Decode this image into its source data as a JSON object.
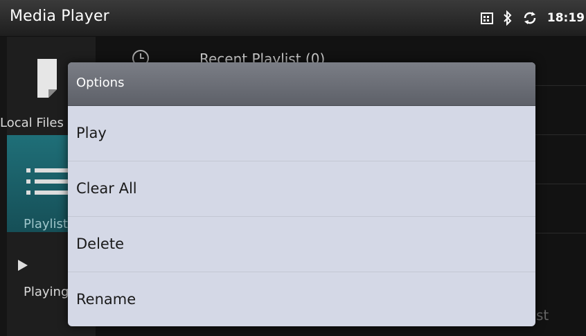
{
  "app": {
    "title": "Media Player",
    "clock": "18:19"
  },
  "status_icons": [
    "calendar-icon",
    "bluetooth-icon",
    "sync-icon"
  ],
  "sidebar": {
    "items": [
      {
        "label": "Local Files",
        "icon": "file-icon",
        "selected": false
      },
      {
        "label": "Playlist",
        "icon": "list-icon",
        "selected": true
      },
      {
        "label": "Playing",
        "icon": "play-icon",
        "selected": false
      }
    ]
  },
  "list": {
    "rows": [
      {
        "label": "Recent Playlist  (0)",
        "icon": "clock-icon"
      },
      {
        "label": ""
      },
      {
        "label": ""
      },
      {
        "label": ""
      },
      {
        "label": "st"
      }
    ]
  },
  "dialog": {
    "title": "Options",
    "options": [
      "Play",
      "Clear All",
      "Delete",
      "Rename"
    ]
  },
  "colors": {
    "dialog_bg": "#d4d8e6",
    "header_bg": "#6b6e76",
    "sidebar_selected": "#1f6f78",
    "titlebar_bg": "#2a2a2a"
  }
}
